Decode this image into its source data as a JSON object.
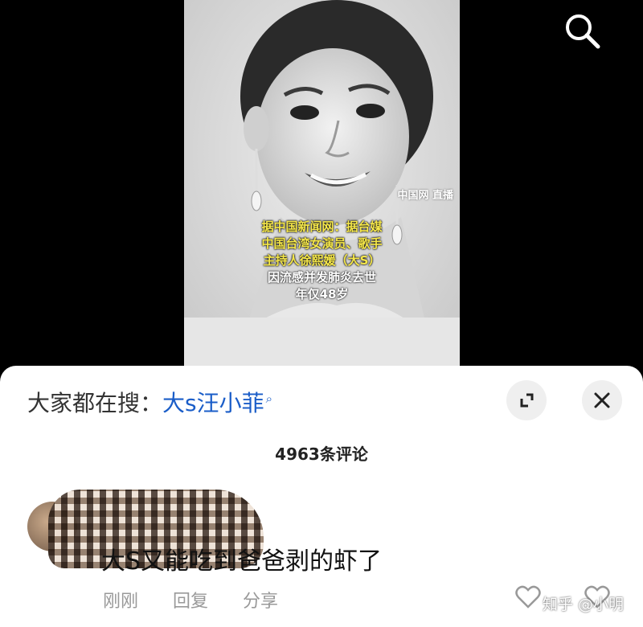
{
  "video": {
    "caption_lines": [
      {
        "text": "据中国新闻网：据台媒",
        "color": "#f6e84a"
      },
      {
        "text": "中国台湾女演员、歌手",
        "color": "#f6e84a"
      },
      {
        "text": "主持人徐熙媛（大S）",
        "color": "#f6e84a"
      },
      {
        "text": "因流感并发肺炎去世",
        "color": "#ffffff"
      },
      {
        "text": "年仅48岁",
        "color": "#ffffff"
      }
    ],
    "watermark": "中国网 直播"
  },
  "top_right": {
    "icon": "search-icon"
  },
  "sheet": {
    "trending_prefix": "大家都在搜：",
    "trending_keyword": "大s汪小菲",
    "trending_icon": "search-icon",
    "expand_icon": "expand-icon",
    "close_icon": "close-icon",
    "comment_count": "4963条评论"
  },
  "comment": {
    "text": "大S又能吃到爸爸剥的虾了",
    "time": "刚刚",
    "reply_label": "回复",
    "share_label": "分享",
    "like_icon": "heart-icon"
  },
  "watermark_footer": "知乎 @小明"
}
